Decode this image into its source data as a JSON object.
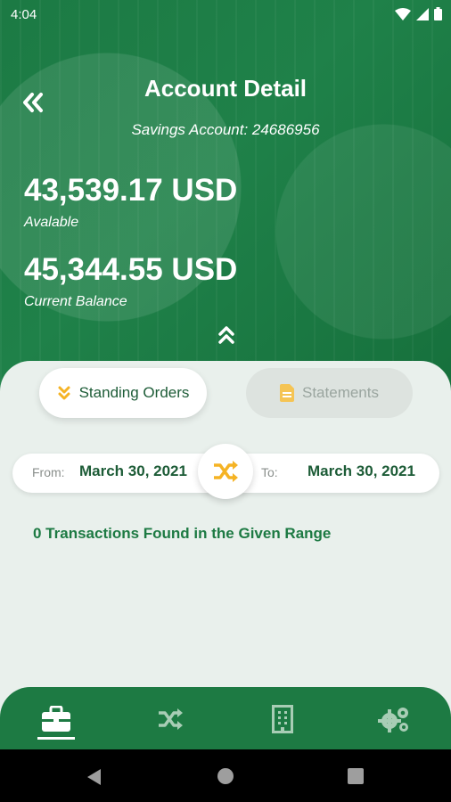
{
  "status_bar": {
    "time": "4:04",
    "wifi_icon": "wifi-icon",
    "signal_icon": "signal-icon",
    "battery_icon": "battery-icon"
  },
  "header": {
    "back_icon": "double-chevron-left-icon",
    "title": "Account Detail",
    "subtitle": "Savings Account: 24686956"
  },
  "balances": {
    "available_amount": "43,539.17 USD",
    "available_label": "Avalable",
    "current_amount": "45,344.55 USD",
    "current_label": "Current Balance",
    "collapse_icon": "double-chevron-up-icon"
  },
  "tabs": [
    {
      "label": "Standing Orders",
      "icon": "double-chevron-down-icon",
      "active": true
    },
    {
      "label": "Statements",
      "icon": "document-icon",
      "active": false
    }
  ],
  "date_range": {
    "from_label": "From:",
    "from_value": "March 30, 2021",
    "to_label": "To:",
    "to_value": "March 30, 2021",
    "swap_icon": "shuffle-icon"
  },
  "result_text": "0 Transactions Found in the Given Range",
  "bottom_nav": [
    {
      "icon": "briefcase-icon",
      "active": true
    },
    {
      "icon": "shuffle-icon",
      "active": false
    },
    {
      "icon": "building-icon",
      "active": false
    },
    {
      "icon": "gears-icon",
      "active": false
    }
  ],
  "colors": {
    "primary": "#1d7a43",
    "accent": "#f5b324",
    "panel": "#e9f0ec"
  }
}
